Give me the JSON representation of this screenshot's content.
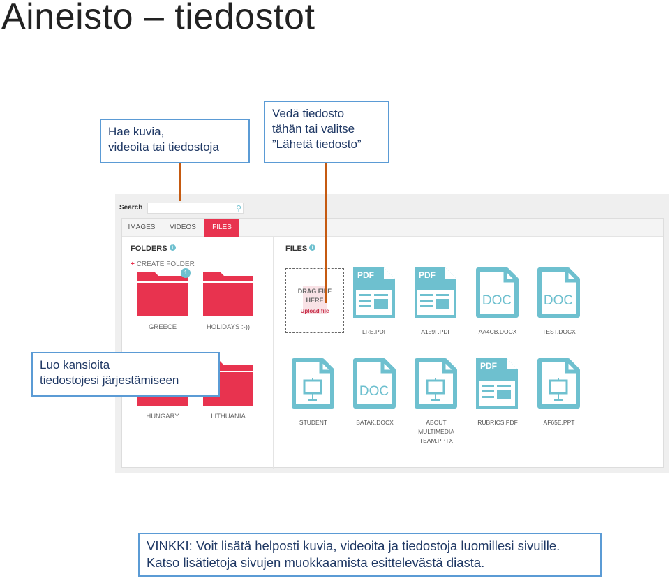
{
  "slide": {
    "title": "Aineisto – tiedostot"
  },
  "callouts": {
    "search": [
      "Hae kuvia,",
      "videoita tai tiedostoja"
    ],
    "upload": [
      "Vedä tiedosto",
      "tähän tai valitse",
      "”Lähetä tiedosto”"
    ],
    "folders": [
      "Luo kansioita",
      "tiedostojesi järjestämiseen"
    ],
    "tip": [
      "VINKKI: Voit lisätä helposti kuvia, videoita ja tiedostoja luomillesi sivuille.",
      "Katso lisätietoja sivujen muokkaamista esittelevästä diasta."
    ]
  },
  "app": {
    "search_label": "Search",
    "search_value": "",
    "search_icon": "magnifier-icon",
    "tabs": [
      {
        "label": "IMAGES",
        "active": false
      },
      {
        "label": "VIDEOS",
        "active": false
      },
      {
        "label": "FILES",
        "active": true
      }
    ],
    "folders_heading": "FOLDERS",
    "info_glyph": "i",
    "create_folder": "CREATE FOLDER",
    "create_glyph": "+",
    "folders": [
      {
        "name": "GREECE",
        "badge": "1"
      },
      {
        "name": "HOLIDAYS :-))"
      },
      {
        "name": "HUNGARY"
      },
      {
        "name": "LITHUANIA"
      }
    ],
    "files_heading": "FILES",
    "drop": {
      "line1": "DRAG FILE",
      "line2": "HERE",
      "upload": "Upload file"
    },
    "files": [
      {
        "name": "LRE.PDF",
        "type": "pdf"
      },
      {
        "name": "A159F.PDF",
        "type": "pdf"
      },
      {
        "name": "AA4CB.DOCX",
        "type": "doc"
      },
      {
        "name": "TEST.DOCX",
        "type": "doc"
      },
      {
        "name": "STUDENT",
        "type": "ppt"
      },
      {
        "name": "BATAK.DOCX",
        "type": "doc"
      },
      {
        "name": "ABOUT MULTIMEDIA TEAM.PPTX",
        "type": "ppt"
      },
      {
        "name": "RUBRICS.PDF",
        "type": "pdf"
      },
      {
        "name": "AF65E.PPT",
        "type": "ppt"
      }
    ],
    "type_labels": {
      "pdf": "PDF",
      "doc": "DOC"
    }
  },
  "colors": {
    "accent": "#e8334f",
    "file_icon": "#6ec0cf",
    "callout_border": "#5b9bd5",
    "connector": "#c55a11"
  }
}
